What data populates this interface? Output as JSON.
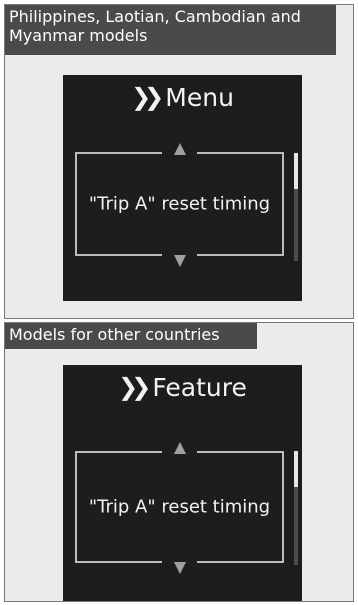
{
  "sections": [
    {
      "tag": "Philippines, Laotian, Cambodian and Myanmar models",
      "screen": {
        "header_icon": "double-chevron-right-icon",
        "title": "Menu",
        "item": "\"Trip A\" reset timing"
      }
    },
    {
      "tag": "Models for other countries",
      "screen": {
        "header_icon": "double-chevron-right-icon",
        "title": "Feature",
        "item": "\"Trip A\" reset timing"
      }
    }
  ],
  "colors": {
    "screen_background": "#1d1d1d",
    "tag_background": "#4a4a4a",
    "panel_background": "#ebebeb",
    "frame": "#bdbdbd"
  }
}
